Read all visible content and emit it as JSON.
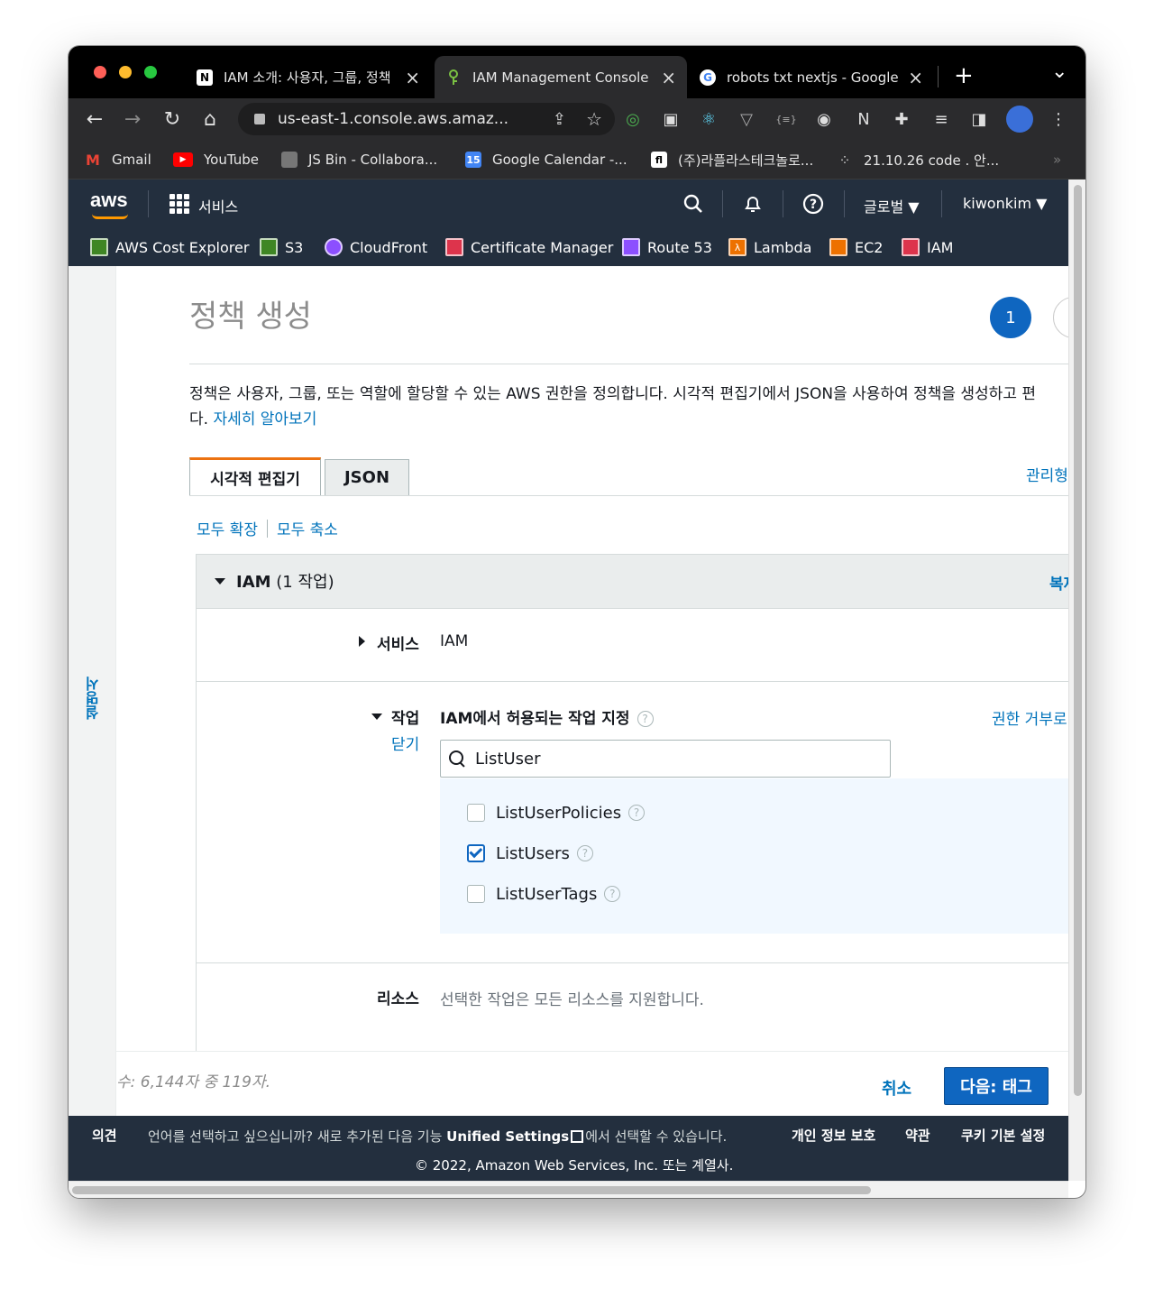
{
  "browser": {
    "tabs": [
      {
        "favicon": "N",
        "title": "IAM 소개: 사용자, 그룹, 정책"
      },
      {
        "favicon": "key",
        "title": "IAM Management Console"
      },
      {
        "favicon": "G",
        "title": "robots txt nextjs - Google"
      }
    ],
    "new_tab": "+",
    "tab_menu": "⌄",
    "url": "us-east-1.console.aws.amaz...",
    "bookmarks": [
      {
        "label": "Gmail",
        "color": "#ea4335"
      },
      {
        "label": "YouTube",
        "color": "#ff0000"
      },
      {
        "label": "JS Bin - Collabora...",
        "color": "#888888"
      },
      {
        "label": "Google Calendar -...",
        "color": "#4285f4"
      },
      {
        "label": "(주)라플라스테크놀로...",
        "color": "#ffffff"
      },
      {
        "label": "21.10.26 code . 안...",
        "color": "#444444"
      }
    ],
    "bookmarks_more": "»"
  },
  "aws_header": {
    "logo": "aws",
    "services_label": "서비스",
    "region_label": "글로벌 ▼",
    "user_label": "kiwonkim ▼",
    "favorites": [
      {
        "label": "AWS Cost Explorer",
        "color": "#3f8624"
      },
      {
        "label": "S3",
        "color": "#3f8624"
      },
      {
        "label": "CloudFront",
        "color": "#8c4fff"
      },
      {
        "label": "Certificate Manager",
        "color": "#dd344c"
      },
      {
        "label": "Route 53",
        "color": "#8c4fff"
      },
      {
        "label": "Lambda",
        "color": "#ed7100"
      },
      {
        "label": "EC2",
        "color": "#ed7100"
      },
      {
        "label": "IAM",
        "color": "#dd344c"
      }
    ]
  },
  "side_rail": {
    "label": "설명서"
  },
  "page": {
    "title": "정책 생성",
    "step_current": "1",
    "description_prefix": "정책은 사용자, 그룹, 또는 역할에 할당할 수 있는 AWS 권한을 정의합니다. 시각적 편집기에서 JSON을 사용하여 정책을 생성하고 편",
    "description_suffix": "다. ",
    "learn_more": "자세히 알아보기",
    "tabs": {
      "visual": "시각적 편집기",
      "json": "JSON"
    },
    "managed_link": "관리형",
    "expand_all": "모두 확장",
    "collapse_all": "모두 축소"
  },
  "policy_panel": {
    "title_bold": "IAM",
    "title_rest": " (1 작업)",
    "copy_link": "복제",
    "service_label": "서비스",
    "service_value": "IAM",
    "actions_label": "작업",
    "close_link": "닫기",
    "actions_heading": "IAM에서 허용되는 작업 지정",
    "deny_link": "권한 거부로",
    "search_value": "ListUser",
    "options": [
      {
        "label": "ListUserPolicies",
        "checked": false
      },
      {
        "label": "ListUsers",
        "checked": true
      },
      {
        "label": "ListUserTags",
        "checked": false
      }
    ],
    "resource_label": "리소스",
    "resource_value": "선택한 작업은 모든 리소스를 지원합니다."
  },
  "bottom": {
    "char_count": "수: 6,144자 중 119자.",
    "cancel": "취소",
    "next": "다음: 태그"
  },
  "footer": {
    "feedback": "의견",
    "language_prefix": "언어를 선택하고 싶으십니까? 새로 추가된 다음 기능 ",
    "unified_settings": "Unified Settings",
    "language_suffix": "에서 선택할 수 있습니다.",
    "privacy": "개인 정보 보호",
    "terms": "약관",
    "cookies": "쿠키 기본 설정",
    "copyright": "© 2022, Amazon Web Services, Inc. 또는 계열사."
  }
}
